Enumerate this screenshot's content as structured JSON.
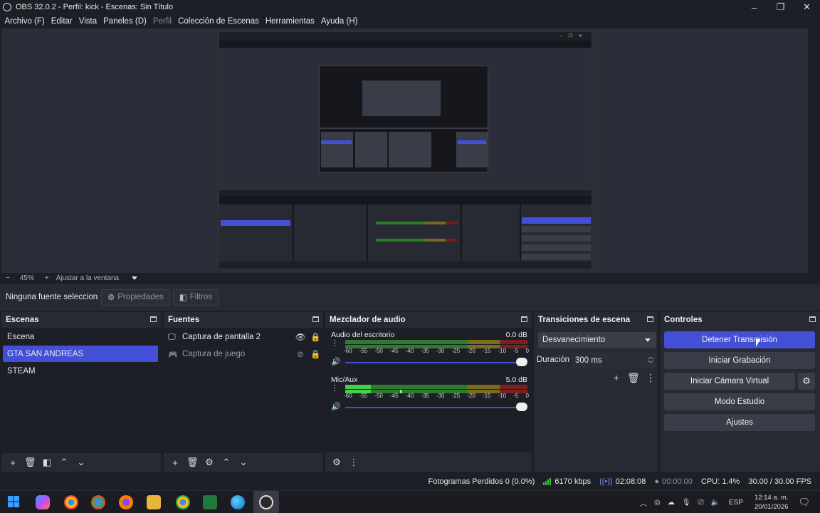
{
  "window": {
    "title": "OBS 32.0.2 - Perfil: kick - Escenas: Sin Título",
    "controls": [
      "–",
      "❐",
      "✕"
    ]
  },
  "menu": [
    {
      "label": "Archivo (F)",
      "disabled": false
    },
    {
      "label": "Editar",
      "disabled": false
    },
    {
      "label": "Vista",
      "disabled": false
    },
    {
      "label": "Paneles (D)",
      "disabled": false
    },
    {
      "label": "Perfil",
      "disabled": true
    },
    {
      "label": "Colección de Escenas",
      "disabled": false
    },
    {
      "label": "Herramientas",
      "disabled": false
    },
    {
      "label": "Ayuda (H)",
      "disabled": false
    }
  ],
  "zoom": {
    "minus": "−",
    "value": "45%",
    "plus": "+",
    "fit_label": "Ajustar a la ventana"
  },
  "source_toolbar": {
    "no_selection": "Ninguna fuente seleccionada",
    "properties": "Propiedades",
    "filters": "Filtros"
  },
  "scenes": {
    "title": "Escenas",
    "items": [
      {
        "label": "Escena",
        "selected": false
      },
      {
        "label": "GTA SAN ANDREAS",
        "selected": true
      },
      {
        "label": "STEAM",
        "selected": false
      }
    ]
  },
  "sources": {
    "title": "Fuentes",
    "items": [
      {
        "label": "Captura de pantalla 2",
        "icon": "monitor-icon",
        "visible": true
      },
      {
        "label": "Captura de juego",
        "icon": "gamepad-icon",
        "visible": false
      }
    ]
  },
  "mixer": {
    "title": "Mezclador de audio",
    "scale": [
      "-60",
      "-55",
      "-50",
      "-45",
      "-40",
      "-35",
      "-30",
      "-25",
      "-20",
      "-15",
      "-10",
      "-5",
      "0"
    ],
    "channels": [
      {
        "name": "Audio del escritorio",
        "db": "0.0 dB",
        "level": 0.0
      },
      {
        "name": "Mic/Aux",
        "db": "5.0 dB",
        "level": 0.15
      }
    ]
  },
  "transitions": {
    "title": "Transiciones de escena",
    "selected": "Desvanecimiento",
    "duration_label": "Duración",
    "duration_value": "300 ms"
  },
  "controls": {
    "title": "Controles",
    "buttons": {
      "stop_stream": "Detener Transmisión",
      "start_record": "Iniciar Grabación",
      "start_virtual_cam": "Iniciar Cámara Virtual",
      "studio_mode": "Modo Estudio",
      "settings": "Ajustes"
    }
  },
  "status": {
    "dropped_frames": "Fotogramas Perdidos 0 (0.0%)",
    "bitrate": "6170 kbps",
    "stream_time": "02:08:08",
    "record_time": "00:00:00",
    "cpu": "CPU: 1.4%",
    "fps": "30.00 / 30.00 FPS"
  },
  "taskbar": {
    "lang": "ESP",
    "time": "12:14 a. m.",
    "date": "20/01/2026"
  },
  "colors": {
    "accent": "#4350d6",
    "panel": "#272a33",
    "bg": "#1d1f26"
  }
}
